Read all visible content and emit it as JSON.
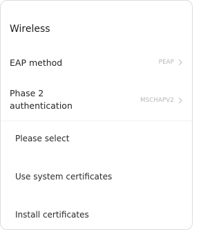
{
  "header": {
    "title": "Wireless"
  },
  "rows": [
    {
      "label": "EAP method",
      "value": "PEAP"
    },
    {
      "label_line1": "Phase 2",
      "label_line2": "authentication",
      "value": "MSCHAPV2"
    }
  ],
  "options": [
    {
      "label": "Please select"
    },
    {
      "label": "Use system certificates"
    },
    {
      "label": "Install certificates"
    }
  ],
  "icons": {
    "row_chevron": "chevron-right-icon"
  },
  "colors": {
    "text": "#222222",
    "value": "#b5b5b5",
    "border": "#dcdcdc"
  }
}
